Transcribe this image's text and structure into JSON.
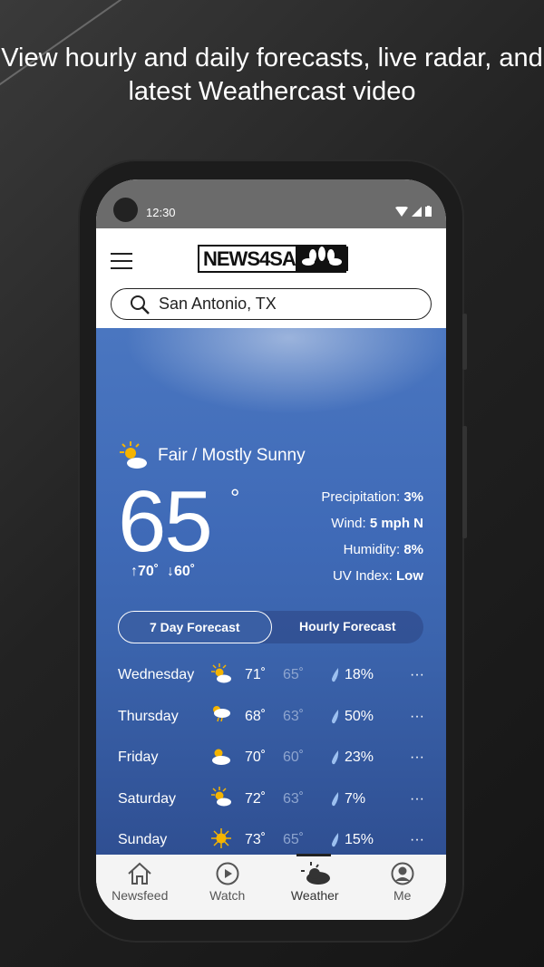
{
  "headline": "View hourly and daily forecasts, live radar, and latest Weathercast video",
  "status": {
    "time": "12:30"
  },
  "header": {
    "logo_text": "NEWS4SA",
    "search_value": "San Antonio, TX"
  },
  "current": {
    "condition": "Fair / Mostly Sunny",
    "temp": "65",
    "deg": "°",
    "hi": "↑70˚",
    "lo": "↓60˚",
    "precip_label": "Precipitation: ",
    "precip": "3%",
    "wind_label": "Wind: ",
    "wind": "5 mph N",
    "humidity_label": "Humidity: ",
    "humidity": "8%",
    "uv_label": "UV Index: ",
    "uv": "Low"
  },
  "tabs": {
    "daily": "7 Day Forecast",
    "hourly": "Hourly Forecast",
    "active": "daily"
  },
  "forecast": [
    {
      "day": "Wednesday",
      "icon": "partly-sunny",
      "hi": "71˚",
      "lo": "65˚",
      "precip": "18%"
    },
    {
      "day": "Thursday",
      "icon": "rain",
      "hi": "68˚",
      "lo": "63˚",
      "precip": "50%"
    },
    {
      "day": "Friday",
      "icon": "mostly-cloudy",
      "hi": "70˚",
      "lo": "60˚",
      "precip": "23%"
    },
    {
      "day": "Saturday",
      "icon": "partly-sunny",
      "hi": "72˚",
      "lo": "63˚",
      "precip": "7%"
    },
    {
      "day": "Sunday",
      "icon": "sunny",
      "hi": "73˚",
      "lo": "65˚",
      "precip": "15%"
    }
  ],
  "more": "···",
  "nav": {
    "newsfeed": "Newsfeed",
    "watch": "Watch",
    "weather": "Weather",
    "me": "Me",
    "active": "weather"
  },
  "colors": {
    "accent_blue": "#4a76c0",
    "sun": "#f5b400"
  }
}
